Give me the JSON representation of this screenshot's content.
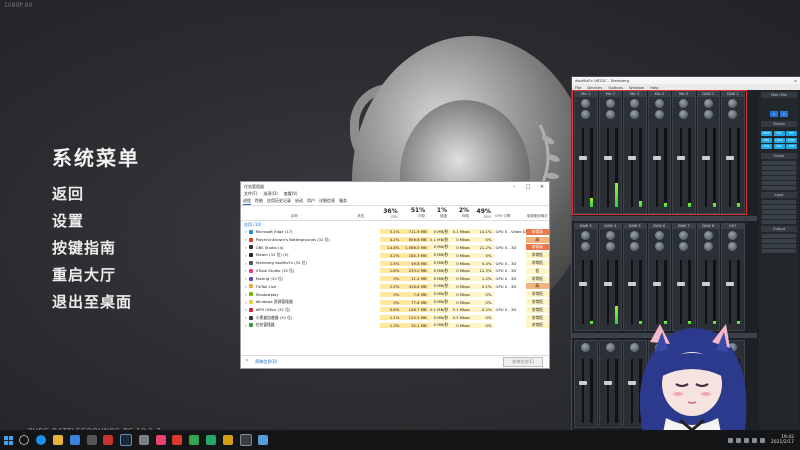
{
  "watermark": "1080P 60",
  "game": {
    "menu_title": "系统菜单",
    "menu_items": [
      "返回",
      "设置",
      "按键指南",
      "重启大厅",
      "退出至桌面"
    ],
    "version": "PUBG.BATTLEGROUNDS PC 10.1.2"
  },
  "task_manager": {
    "title": "任务管理器",
    "menu": [
      "文件(F)",
      "选项(O)",
      "查看(V)"
    ],
    "tabs": [
      "进程",
      "性能",
      "应用历史记录",
      "启动",
      "用户",
      "详细信息",
      "服务"
    ],
    "columns": [
      {
        "pct": "",
        "label": "名称"
      },
      {
        "pct": "",
        "label": "状态"
      },
      {
        "pct": "36%",
        "label": "CPU"
      },
      {
        "pct": "51%",
        "label": "内存"
      },
      {
        "pct": "1%",
        "label": "磁盘"
      },
      {
        "pct": "2%",
        "label": "网络"
      },
      {
        "pct": "49%",
        "label": "GPU"
      },
      {
        "pct": "",
        "label": "GPU 引擎"
      },
      {
        "pct": "",
        "label": "电源使用情况"
      }
    ],
    "section": "应用 (14)",
    "rows": [
      {
        "name": "Microsoft Edge (17)",
        "cpu": "0.1%",
        "mem": "711.9 MB",
        "disk": "0 MB/秒",
        "net": "0.1 Mbps",
        "gpu": "14.1%",
        "engine": "GPU 0 - Video Decode",
        "power": "非常高",
        "powerLevel": "vhigh",
        "color": "#1f8fe0"
      },
      {
        "name": "PlayerUnknown's Battlegrounds (32 位)",
        "cpu": "4.2%",
        "mem": "656.6 MB",
        "disk": "0.1 MB/秒",
        "net": "0 Mbps",
        "gpu": "0%",
        "engine": "",
        "power": "高",
        "powerLevel": "high",
        "color": "#d83b2b"
      },
      {
        "name": "OBS Studio (4)",
        "cpu": "14.8%",
        "mem": "1,566.0 MB",
        "disk": "0 MB/秒",
        "net": "0 Mbps",
        "gpu": "21.2%",
        "engine": "GPU 0 - 3D",
        "power": "非常高",
        "powerLevel": "vhigh",
        "color": "#333333"
      },
      {
        "name": "Steam (32 位) (5)",
        "cpu": "0.2%",
        "mem": "180.3 MB",
        "disk": "0 MB/秒",
        "net": "0 Mbps",
        "gpu": "0%",
        "engine": "",
        "power": "非常低",
        "powerLevel": "low",
        "color": "#1b2838"
      },
      {
        "name": "Steinberg dspMixFx (32 位)",
        "cpu": "1.5%",
        "mem": "49.8 MB",
        "disk": "0 MB/秒",
        "net": "0 Mbps",
        "gpu": "0.4%",
        "engine": "GPU 0 - 3D",
        "power": "非常低",
        "powerLevel": "low",
        "color": "#555555"
      },
      {
        "name": "VTube Studio (32 位)",
        "cpu": "1.8%",
        "mem": "233.0 MB",
        "disk": "0 MB/秒",
        "net": "0 Mbps",
        "gpu": "12.3%",
        "engine": "GPU 0 - 3D",
        "power": "低",
        "powerLevel": "low",
        "color": "#e6446e"
      },
      {
        "name": "Facerig (32 位)",
        "cpu": "0%",
        "mem": "11.4 MB",
        "disk": "0 MB/秒",
        "net": "0 Mbps",
        "gpu": "1.2%",
        "engine": "GPU 0 - 3D",
        "power": "非常低",
        "powerLevel": "low",
        "color": "#6a3fb8"
      },
      {
        "name": "TikTok Live",
        "cpu": "2.5%",
        "mem": "416.6 MB",
        "disk": "0 MB/秒",
        "net": "0 Mbps",
        "gpu": "0.1%",
        "engine": "GPU 0 - 3D",
        "power": "高",
        "powerLevel": "high",
        "color": "#f2a33a"
      },
      {
        "name": "Shadowplay",
        "cpu": "0%",
        "mem": "7.8 MB",
        "disk": "0 MB/秒",
        "net": "0 Mbps",
        "gpu": "0%",
        "engine": "",
        "power": "非常低",
        "powerLevel": "low",
        "color": "#76b900"
      },
      {
        "name": "Windows 资源管理器",
        "cpu": "0%",
        "mem": "77.8 MB",
        "disk": "0 MB/秒",
        "net": "0 Mbps",
        "gpu": "0%",
        "engine": "",
        "power": "非常低",
        "powerLevel": "low",
        "color": "#f2c744"
      },
      {
        "name": "WPS Office (32 位)",
        "cpu": "0.6%",
        "mem": "148.7 MB",
        "disk": "0.1 MB/秒",
        "net": "0.1 Mbps",
        "gpu": "0.2%",
        "engine": "GPU 0 - 3D",
        "power": "非常低",
        "powerLevel": "low",
        "color": "#d02b2b"
      },
      {
        "name": "小黑盒加速器 (32 位)",
        "cpu": "1.1%",
        "mem": "120.5 MB",
        "disk": "0 MB/秒",
        "net": "0.3 Mbps",
        "gpu": "0%",
        "engine": "",
        "power": "非常低",
        "powerLevel": "low",
        "color": "#333333"
      },
      {
        "name": "任务管理器",
        "cpu": "1.3%",
        "mem": "32.1 MB",
        "disk": "0 MB/秒",
        "net": "0 Mbps",
        "gpu": "0%",
        "engine": "",
        "power": "非常低",
        "powerLevel": "low",
        "color": "#3a9a3a"
      }
    ],
    "footer_less": "简略信息(D)",
    "footer_end_task": "结束任务(E)"
  },
  "mixer": {
    "title": "dspMixFx UR22C - Steinberg",
    "menu": [
      "File",
      "Devices",
      "Options",
      "Window",
      "Help"
    ],
    "strips_top": [
      "Mic 1",
      "Mic 2",
      "Mic 3",
      "Mic 4",
      "Mic 5",
      "DAW 1",
      "DAW 2"
    ],
    "strips_bottom": [
      "DAW 3",
      "DAW 4",
      "DAW 5",
      "DAW 6",
      "DAW 7",
      "DAW 8",
      "OUT"
    ],
    "right_labels": [
      "Main Mix",
      "Stereo",
      "Scene",
      "Input",
      "Output"
    ],
    "cyan_buttons": [
      "MON",
      "FX1",
      "FX2",
      "REV",
      "LOOP",
      "DAW",
      "CH1",
      "CH2",
      "CH3"
    ]
  },
  "taskbar": {
    "clock_time": "19:42",
    "clock_date": "2021/2/17"
  }
}
